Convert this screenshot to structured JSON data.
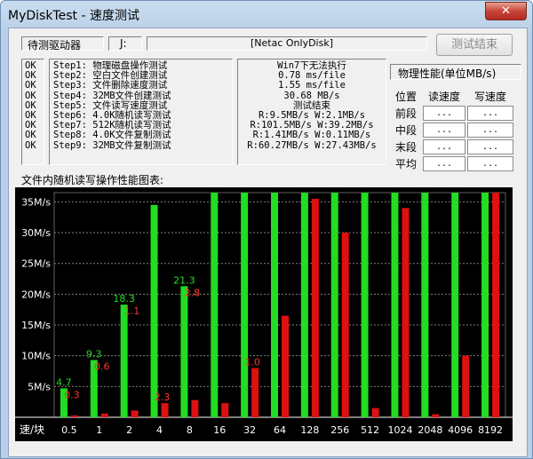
{
  "window": {
    "title": "MyDiskTest - 速度测试",
    "close_icon": "close-icon"
  },
  "drive": {
    "status": "待测驱动器",
    "letter": "J:",
    "name": "[Netac OnlyDisk]"
  },
  "buttons": {
    "finish": "测试结束"
  },
  "steps": [
    {
      "status": "OK",
      "text": "Step1: 物理磁盘操作测试"
    },
    {
      "status": "OK",
      "text": "Step2: 空白文件创建测试"
    },
    {
      "status": "OK",
      "text": "Step3: 文件删除速度测试"
    },
    {
      "status": "OK",
      "text": "Step4: 32MB文件创建测试"
    },
    {
      "status": "OK",
      "text": "Step5: 文件读写速度测试"
    },
    {
      "status": "OK",
      "text": "Step6: 4.0K随机读写测试"
    },
    {
      "status": "OK",
      "text": "Step7: 512K随机读写测试"
    },
    {
      "status": "OK",
      "text": "Step8: 4.0K文件复制测试"
    },
    {
      "status": "OK",
      "text": "Step9: 32MB文件复制测试"
    }
  ],
  "results": [
    "Win7下无法执行",
    "0.78 ms/file",
    "1.55 ms/file",
    "30.68 MB/s",
    "测试结束",
    "R:9.5MB/s W:2.1MB/s",
    "R:101.5MB/s W:39.2MB/s",
    "R:1.41MB/s W:0.11MB/s",
    "R:60.27MB/s W:27.43MB/s"
  ],
  "perf": {
    "title": "物理性能(单位MB/s)",
    "headers": [
      "位置",
      "读速度",
      "写速度"
    ],
    "rows": [
      {
        "pos": "前段",
        "read": "...",
        "write": "..."
      },
      {
        "pos": "中段",
        "read": "...",
        "write": "..."
      },
      {
        "pos": "末段",
        "read": "...",
        "write": "..."
      },
      {
        "pos": "平均",
        "read": "...",
        "write": "..."
      }
    ]
  },
  "chart_title": "文件内随机读写操作性能图表:",
  "chart_data": {
    "type": "bar",
    "x_label": "速/块",
    "categories": [
      "0.5",
      "1",
      "2",
      "4",
      "8",
      "16",
      "32",
      "64",
      "128",
      "256",
      "512",
      "1024",
      "2048",
      "4096",
      "8192"
    ],
    "series": [
      {
        "name": "读",
        "color": "#22dd22",
        "values": [
          4.7,
          9.3,
          18.3,
          34.5,
          21.3,
          40,
          40,
          40,
          40,
          40,
          40,
          40,
          40,
          40,
          40
        ]
      },
      {
        "name": "写",
        "color": "#dd1111",
        "values": [
          0.3,
          0.6,
          1.1,
          2.3,
          2.8,
          2.3,
          8,
          16.5,
          35.5,
          30,
          1.5,
          34,
          0.5,
          10,
          40
        ]
      }
    ],
    "data_labels_read": [
      "4.7",
      "9.3",
      "18.3",
      "",
      "21.3",
      "",
      "",
      "",
      "",
      "",
      "",
      "",
      "",
      "",
      ""
    ],
    "data_labels_write": [
      "0.3",
      "0.6",
      "1.1",
      "2.3",
      "2.8",
      "",
      "1.0",
      "",
      "",
      "",
      "",
      "",
      "",
      "",
      ""
    ],
    "y_ticks": [
      "5M/s",
      "10M/s",
      "15M/s",
      "20M/s",
      "25M/s",
      "30M/s",
      "35M/s"
    ],
    "y_tick_values": [
      5,
      10,
      15,
      20,
      25,
      30,
      35
    ],
    "ylim": [
      0,
      36.5
    ],
    "grid": true
  }
}
